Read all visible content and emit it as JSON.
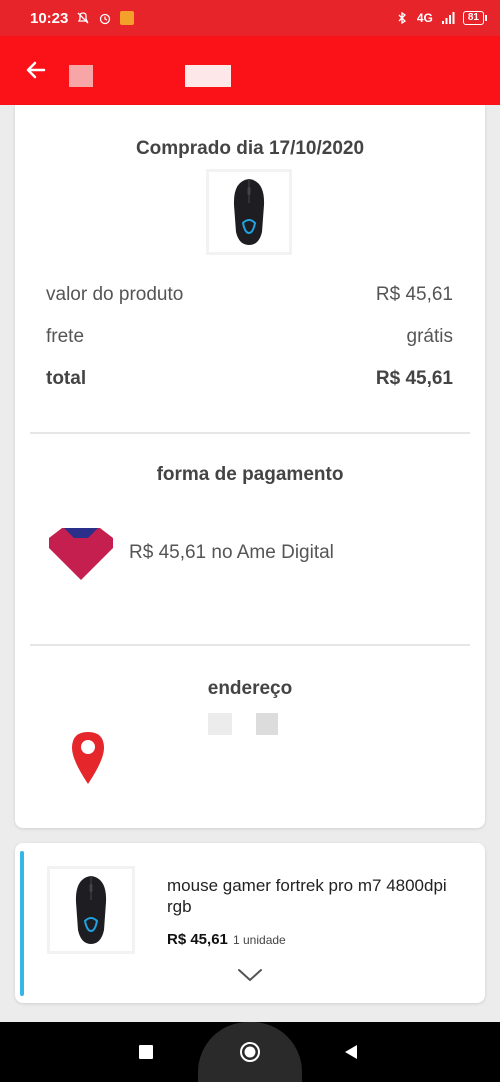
{
  "status_bar": {
    "time": "10:23",
    "network": "4G",
    "battery": "81"
  },
  "order": {
    "purchased_label": "Comprado dia 17/10/2020",
    "rows": [
      {
        "label": "valor do produto",
        "value": "R$ 45,61"
      },
      {
        "label": "frete",
        "value": "grátis"
      },
      {
        "label": "total",
        "value": "R$ 45,61"
      }
    ]
  },
  "payment": {
    "title": "forma de pagamento",
    "text": "R$ 45,61 no Ame Digital"
  },
  "address": {
    "title": "endereço"
  },
  "item": {
    "name": "mouse gamer fortrek pro m7 4800dpi rgb",
    "price": "R$ 45,61",
    "quantity": "1 unidade"
  },
  "colors": {
    "app_bar": "#fb1219",
    "status_bar": "#e8242b",
    "accent_bar": "#35b6e6",
    "pin": "#e5262a",
    "ame_logo": "#c41f4e"
  },
  "icons": {
    "back": "arrow-left-icon",
    "location": "map-pin-icon",
    "ame": "ame-digital-logo",
    "chevron": "chevron-down-icon"
  }
}
